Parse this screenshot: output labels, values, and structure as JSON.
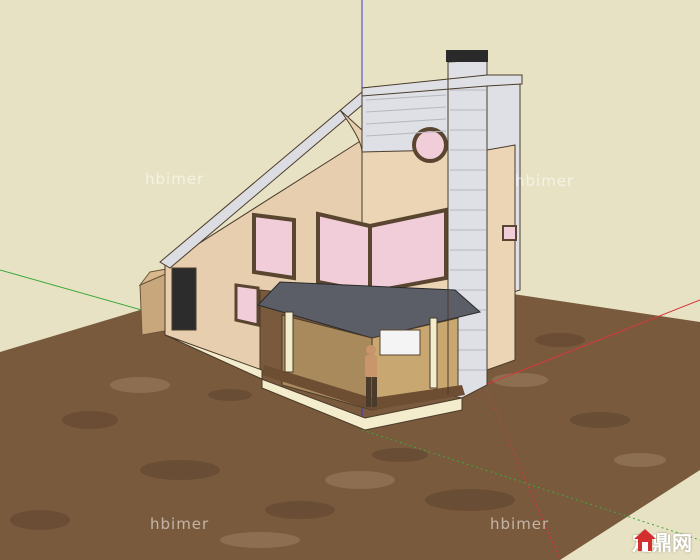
{
  "scene": {
    "sky_color": "#e8e2c4",
    "ground_color": "#7a5a3d",
    "axis_colors": {
      "red": "#d23a3a",
      "green": "#3aa83a",
      "blue": "#3a3ad2"
    },
    "wall_color": "#e6ceae",
    "siding_color": "#dfe0e6",
    "roof_color": "#5b5e66",
    "glass_color": "#f1cdd9"
  },
  "watermarks": [
    "hbimer",
    "hbimer",
    "hbimer",
    "hbimer"
  ],
  "brand": {
    "name": "定鼎网",
    "icon": "house-logo-icon"
  }
}
